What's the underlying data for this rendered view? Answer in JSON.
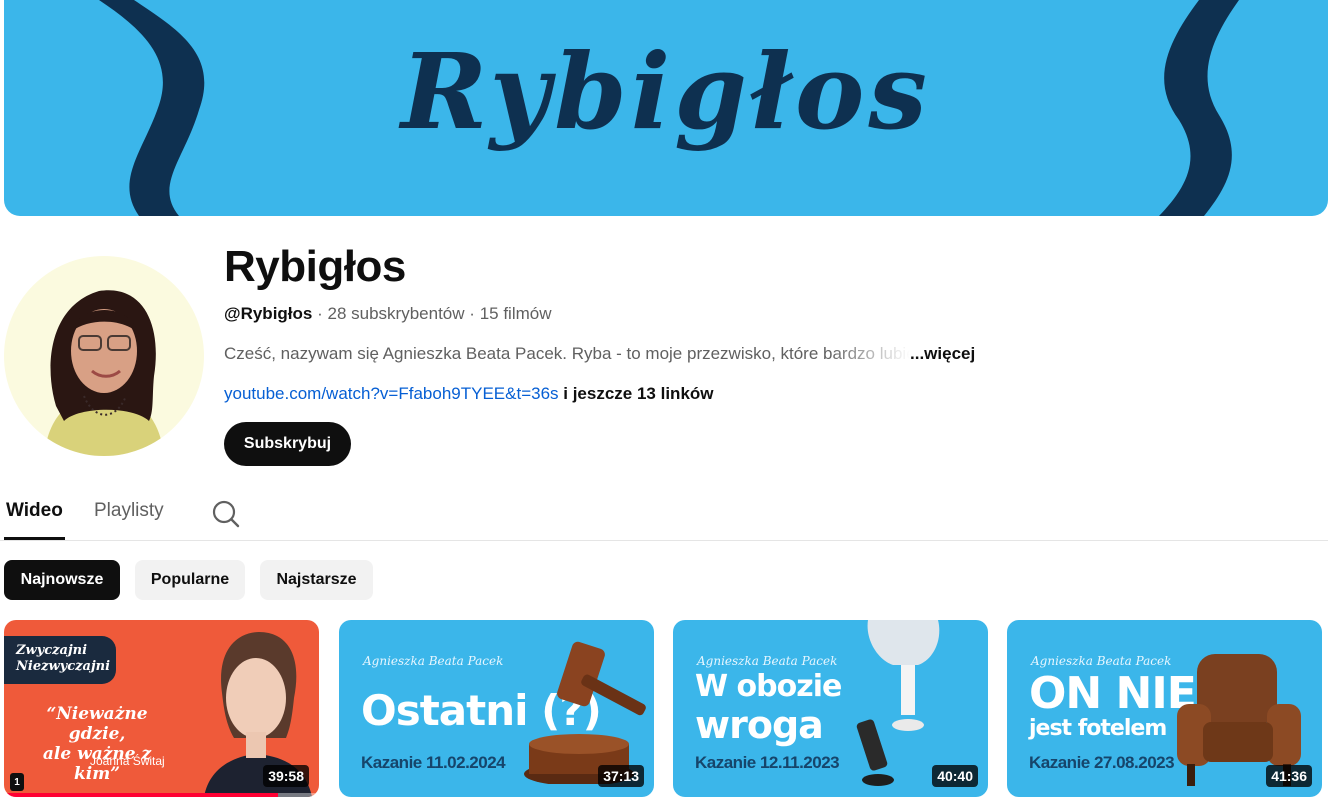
{
  "banner": {
    "title": "Rybigłos"
  },
  "channel": {
    "name": "Rybigłos",
    "handle": "@Rybigłos",
    "subscribers": "28 subskrybentów",
    "videos": "15 filmów",
    "separator": "·",
    "description": "Cześć, nazywam się Agnieszka Beata Pacek. Ryba - to moje przezwisko, które bardzo lubię",
    "description_more": "...więcej",
    "link": "youtube.com/watch?v=Ffaboh9TYEE&t=36s",
    "links_more": "i jeszcze 13 linków",
    "subscribe_label": "Subskrybuj"
  },
  "tabs": [
    {
      "label": "Wideo",
      "active": true
    },
    {
      "label": "Playlisty",
      "active": false
    }
  ],
  "chips": [
    {
      "label": "Najnowsze",
      "active": true
    },
    {
      "label": "Popularne",
      "active": false
    },
    {
      "label": "Najstarsze",
      "active": false
    }
  ],
  "videos": [
    {
      "badge_line1": "Zwyczajni",
      "badge_line2": "Niezwyczajni",
      "quote_line1": "“Nieważne gdzie,",
      "quote_line2": "ale ważne z kim”",
      "speaker": "Joanna Świtaj",
      "episode": "1",
      "duration": "39:58",
      "progress": 0.87
    },
    {
      "author": "Agnieszka Beata Pacek",
      "title_line1": "Ostatni (?)",
      "subtitle": "Kazanie 11.02.2024",
      "duration": "37:13"
    },
    {
      "author": "Agnieszka Beata Pacek",
      "title_line1": "W obozie",
      "title_line2": "wroga",
      "subtitle": "Kazanie 12.11.2023",
      "duration": "40:40"
    },
    {
      "author": "Agnieszka Beata Pacek",
      "title_line1": "ON NIE",
      "title_line2": "jest fotelem",
      "subtitle": "Kazanie 27.08.2023",
      "duration": "41:36"
    }
  ],
  "colors": {
    "banner_bg": "#3bb6ea",
    "banner_ink": "#0e3050",
    "link": "#065fd4",
    "thumb_red": "#ef5a3a",
    "progress": "#ff0033"
  }
}
